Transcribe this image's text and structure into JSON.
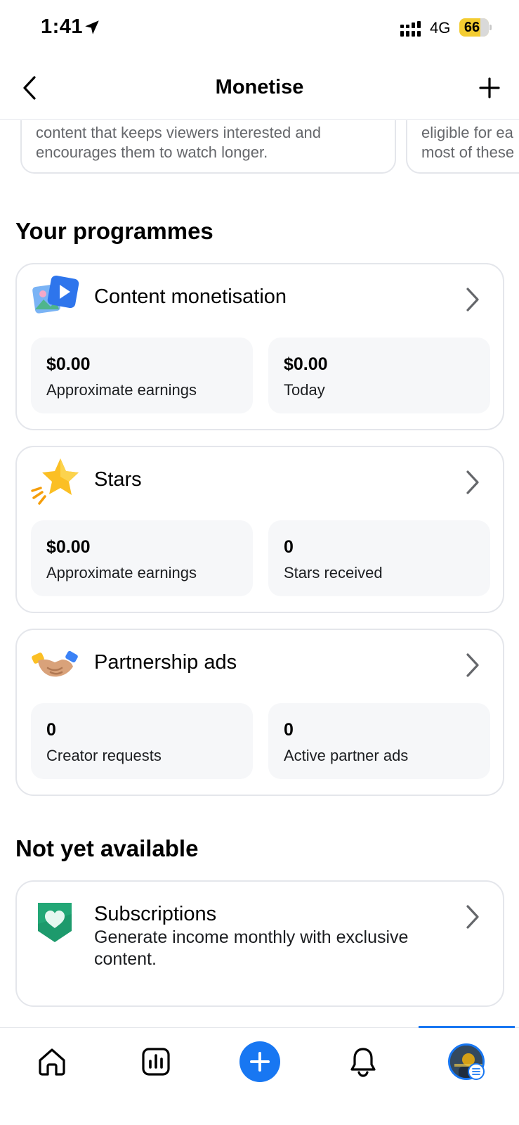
{
  "status_bar": {
    "time": "1:41",
    "network": "4G",
    "battery": "66",
    "battery_level_percent": 66
  },
  "header": {
    "title": "Monetise",
    "back_icon": "chevron-left-icon",
    "add_icon": "plus-icon"
  },
  "carousel": {
    "cards": [
      {
        "text": "content that keeps viewers interested and\nencourages them to watch longer."
      },
      {
        "text": "eligible for ea\nmost of these"
      }
    ]
  },
  "your_programmes": {
    "title": "Your programmes",
    "items": [
      {
        "name": "Content monetisation",
        "icon": "video-photo-icon",
        "stats": [
          {
            "value": "$0.00",
            "label": "Approximate earnings"
          },
          {
            "value": "$0.00",
            "label": "Today"
          }
        ]
      },
      {
        "name": "Stars",
        "icon": "star-icon",
        "stats": [
          {
            "value": "$0.00",
            "label": "Approximate earnings"
          },
          {
            "value": "0",
            "label": "Stars received"
          }
        ]
      },
      {
        "name": "Partnership ads",
        "icon": "handshake-icon",
        "stats": [
          {
            "value": "0",
            "label": "Creator requests"
          },
          {
            "value": "0",
            "label": "Active partner ads"
          }
        ]
      }
    ]
  },
  "not_yet_available": {
    "title": "Not yet available",
    "items": [
      {
        "name": "Subscriptions",
        "icon": "heart-shield-icon",
        "description": "Generate income monthly with exclusive content."
      }
    ]
  },
  "tab_bar": {
    "tabs": [
      {
        "name": "home",
        "icon": "home-icon"
      },
      {
        "name": "insights",
        "icon": "bar-chart-icon"
      },
      {
        "name": "create",
        "icon": "plus-circle-icon"
      },
      {
        "name": "notifications",
        "icon": "bell-icon"
      },
      {
        "name": "profile",
        "icon": "avatar"
      }
    ],
    "active_tab": "profile",
    "accent_color": "#1877f2"
  },
  "colors": {
    "accent": "#1877f2",
    "battery": "#f3cc31",
    "subscriptions_icon": "#1d9a6c"
  }
}
